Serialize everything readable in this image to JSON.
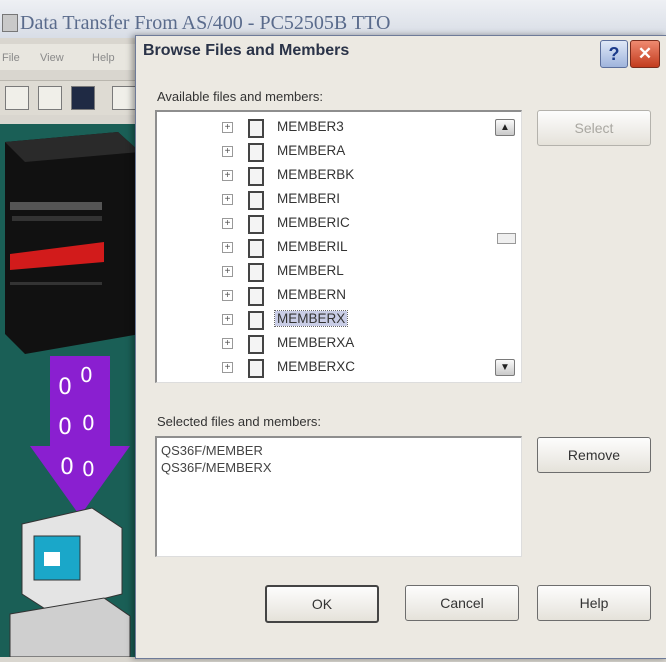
{
  "background_window": {
    "title": "Data Transfer From AS/400 - PC52505B TTO",
    "menus": [
      "File",
      "View",
      "Help"
    ]
  },
  "dialog": {
    "title": "Browse Files and Members",
    "help_glyph": "?",
    "close_glyph": "✕",
    "available_label": "Available files and members:",
    "available_items": [
      {
        "label": "MEMBER3",
        "selected": false
      },
      {
        "label": "MEMBERA",
        "selected": false
      },
      {
        "label": "MEMBERBK",
        "selected": false
      },
      {
        "label": "MEMBERI",
        "selected": false
      },
      {
        "label": "MEMBERIC",
        "selected": false
      },
      {
        "label": "MEMBERIL",
        "selected": false
      },
      {
        "label": "MEMBERL",
        "selected": false
      },
      {
        "label": "MEMBERN",
        "selected": false
      },
      {
        "label": "MEMBERX",
        "selected": true
      },
      {
        "label": "MEMBERXA",
        "selected": false
      },
      {
        "label": "MEMBERXC",
        "selected": false
      }
    ],
    "selected_label": "Selected files and members:",
    "selected_items": [
      "QS36F/MEMBER",
      "QS36F/MEMBERX"
    ],
    "buttons": {
      "select": "Select",
      "remove": "Remove",
      "ok": "OK",
      "cancel": "Cancel",
      "help": "Help"
    },
    "scroll_up_glyph": "▲",
    "scroll_down_glyph": "▼",
    "expand_glyph": "+"
  }
}
